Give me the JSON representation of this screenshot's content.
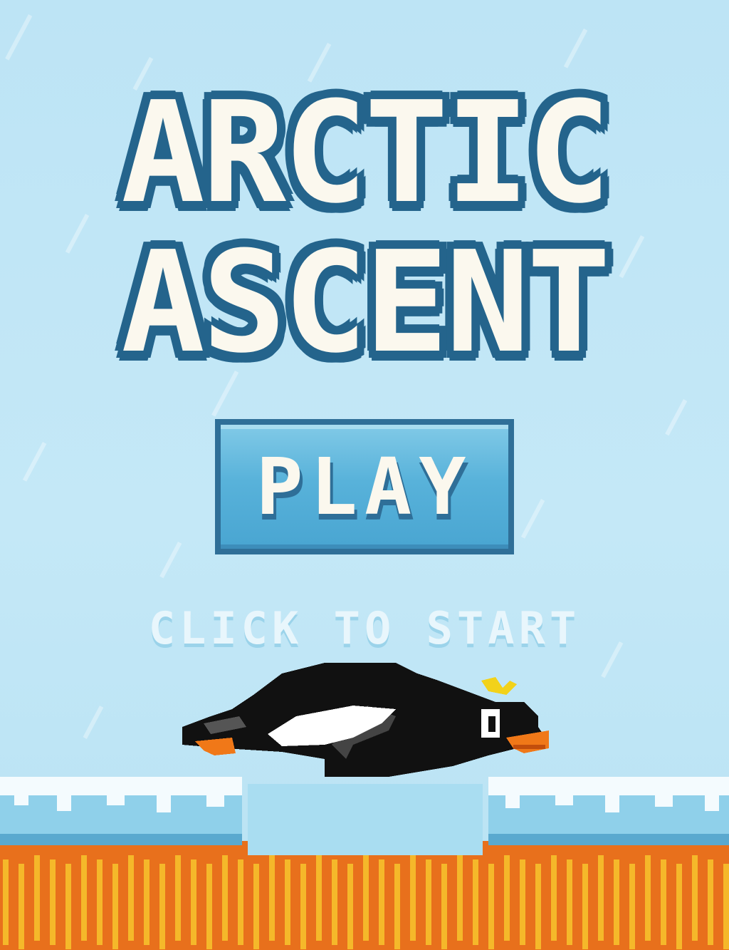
{
  "game": {
    "title_line_1": "ARCTIC",
    "title_line_2": "ASCENT",
    "play_label": "PLAY",
    "hint_text": "CLICK TO START"
  },
  "colors": {
    "sky": "#bfe6f6",
    "title_fill": "#fbf8ee",
    "title_outline": "#24648c",
    "button_fill": "#58b2da",
    "button_border": "#2f6f98",
    "snow": "#f4fbfe",
    "ice": "#8fd0ea",
    "lava": "#e8701c",
    "lava_highlight": "#f5b82a",
    "penguin_body": "#111111",
    "penguin_belly": "#ffffff",
    "penguin_beak": "#f07818",
    "penguin_crest": "#f2d21a"
  },
  "icons": {
    "character": "penguin-sprite"
  }
}
